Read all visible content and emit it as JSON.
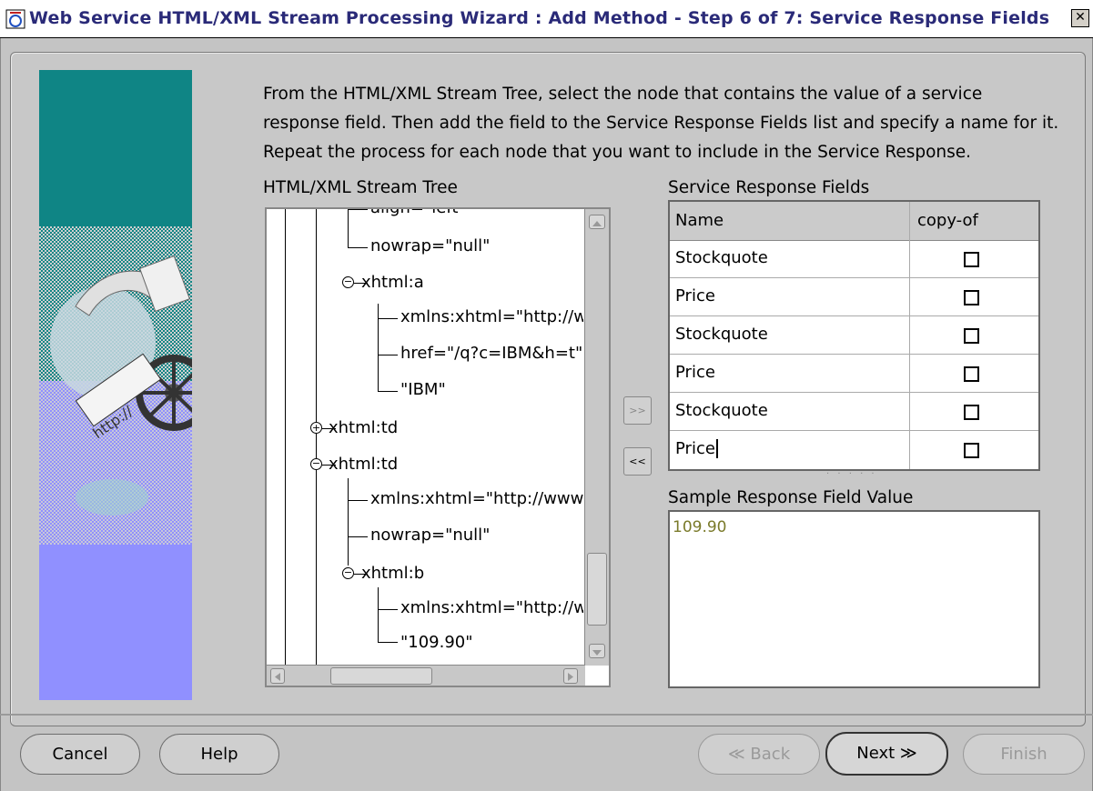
{
  "window": {
    "title": "Web Service HTML/XML Stream Processing Wizard : Add Method - Step 6 of 7: Service Response Fields",
    "close_label": "✕"
  },
  "instructions": "From the HTML/XML Stream Tree, select the node that contains the value of a service response field. Then add the field to the Service Response Fields list and specify a name for it. Repeat the process for each node that you want to include in the Service Response.",
  "tree": {
    "label": "HTML/XML Stream Tree",
    "nodes": [
      "align=\"left\"",
      "nowrap=\"null\"",
      "xhtml:a",
      "xmlns:xhtml=\"http://w",
      "href=\"/q?c=IBM&h=t\"",
      "\"IBM\"",
      "xhtml:td",
      "xhtml:td",
      "xmlns:xhtml=\"http://www.",
      "nowrap=\"null\"",
      "xhtml:b",
      "xmlns:xhtml=\"http://w",
      "\"109.90\""
    ]
  },
  "move_buttons": {
    "add": ">>",
    "remove": "<<"
  },
  "fields": {
    "label": "Service Response Fields",
    "columns": [
      "Name",
      "copy-of"
    ],
    "rows": [
      {
        "name": "Stockquote",
        "copy_of": false
      },
      {
        "name": "Price",
        "copy_of": false
      },
      {
        "name": "Stockquote",
        "copy_of": false
      },
      {
        "name": "Price",
        "copy_of": false
      },
      {
        "name": "Stockquote",
        "copy_of": false
      },
      {
        "name": "Price",
        "copy_of": false
      }
    ]
  },
  "sample": {
    "label": "Sample Response Field Value",
    "value": "109.90"
  },
  "buttons": {
    "cancel": "Cancel",
    "help": "Help",
    "back": "≪ Back",
    "next": "Next ≫",
    "finish": "Finish"
  },
  "colors": {
    "title_text": "#2a2a78",
    "side_teal": "#0f8585",
    "side_purple": "#9090ff",
    "sample_value": "#7a7a2a"
  }
}
